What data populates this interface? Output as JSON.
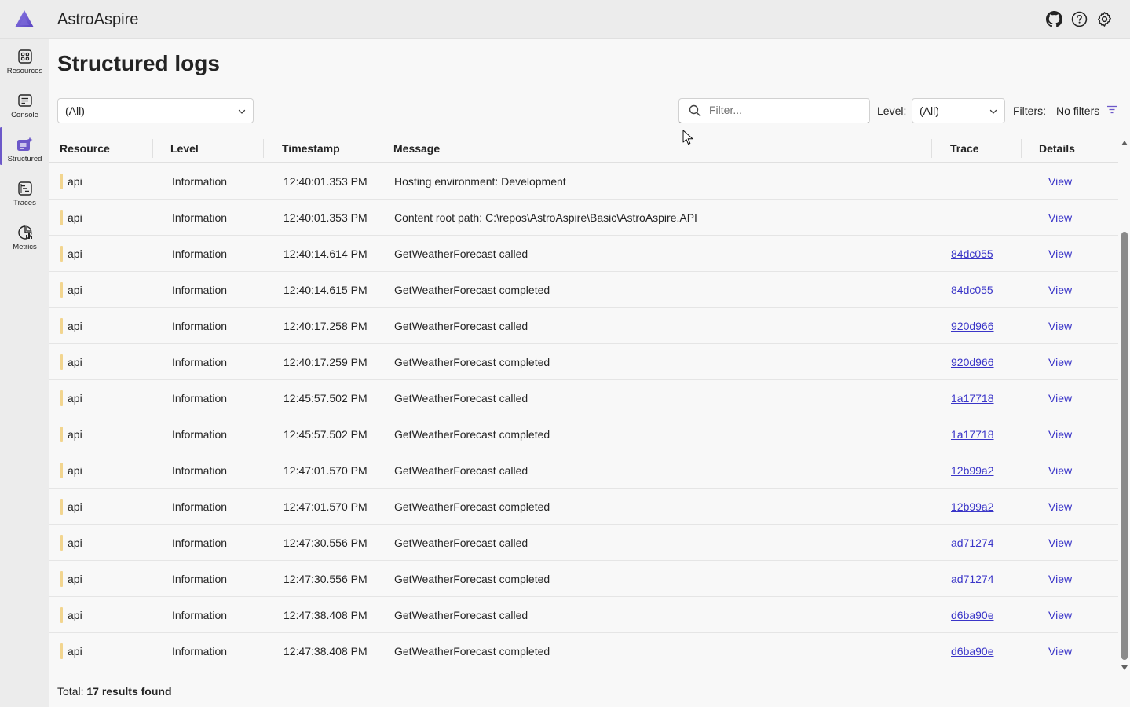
{
  "app": {
    "title": "AstroAspire"
  },
  "header": {
    "icons": [
      "github-icon",
      "help-icon",
      "settings-icon"
    ]
  },
  "sidebar": {
    "items": [
      {
        "label": "Resources",
        "icon": "resources-grid-icon",
        "active": false
      },
      {
        "label": "Console",
        "icon": "console-icon",
        "active": false
      },
      {
        "label": "Structured",
        "icon": "structured-logs-icon",
        "active": true
      },
      {
        "label": "Traces",
        "icon": "traces-icon",
        "active": false
      },
      {
        "label": "Metrics",
        "icon": "metrics-icon",
        "active": false
      }
    ]
  },
  "page": {
    "title": "Structured logs"
  },
  "toolbar": {
    "resource_selected": "(All)",
    "filter_placeholder": "Filter...",
    "level_label": "Level:",
    "level_selected": "(All)",
    "filters_label": "Filters:",
    "filters_value": "No filters"
  },
  "table": {
    "columns": [
      "Resource",
      "Level",
      "Timestamp",
      "Message",
      "Trace",
      "Details"
    ],
    "rows": [
      {
        "resource": "api",
        "level": "Information",
        "timestamp": "12:40:01.353 PM",
        "message": "Hosting environment: Development",
        "trace": "",
        "details": "View"
      },
      {
        "resource": "api",
        "level": "Information",
        "timestamp": "12:40:01.353 PM",
        "message": "Content root path: C:\\repos\\AstroAspire\\Basic\\AstroAspire.API",
        "trace": "",
        "details": "View"
      },
      {
        "resource": "api",
        "level": "Information",
        "timestamp": "12:40:14.614 PM",
        "message": "GetWeatherForecast called",
        "trace": "84dc055",
        "details": "View"
      },
      {
        "resource": "api",
        "level": "Information",
        "timestamp": "12:40:14.615 PM",
        "message": "GetWeatherForecast completed",
        "trace": "84dc055",
        "details": "View"
      },
      {
        "resource": "api",
        "level": "Information",
        "timestamp": "12:40:17.258 PM",
        "message": "GetWeatherForecast called",
        "trace": "920d966",
        "details": "View"
      },
      {
        "resource": "api",
        "level": "Information",
        "timestamp": "12:40:17.259 PM",
        "message": "GetWeatherForecast completed",
        "trace": "920d966",
        "details": "View"
      },
      {
        "resource": "api",
        "level": "Information",
        "timestamp": "12:45:57.502 PM",
        "message": "GetWeatherForecast called",
        "trace": "1a17718",
        "details": "View"
      },
      {
        "resource": "api",
        "level": "Information",
        "timestamp": "12:45:57.502 PM",
        "message": "GetWeatherForecast completed",
        "trace": "1a17718",
        "details": "View"
      },
      {
        "resource": "api",
        "level": "Information",
        "timestamp": "12:47:01.570 PM",
        "message": "GetWeatherForecast called",
        "trace": "12b99a2",
        "details": "View"
      },
      {
        "resource": "api",
        "level": "Information",
        "timestamp": "12:47:01.570 PM",
        "message": "GetWeatherForecast completed",
        "trace": "12b99a2",
        "details": "View"
      },
      {
        "resource": "api",
        "level": "Information",
        "timestamp": "12:47:30.556 PM",
        "message": "GetWeatherForecast called",
        "trace": "ad71274",
        "details": "View"
      },
      {
        "resource": "api",
        "level": "Information",
        "timestamp": "12:47:30.556 PM",
        "message": "GetWeatherForecast completed",
        "trace": "ad71274",
        "details": "View"
      },
      {
        "resource": "api",
        "level": "Information",
        "timestamp": "12:47:38.408 PM",
        "message": "GetWeatherForecast called",
        "trace": "d6ba90e",
        "details": "View"
      },
      {
        "resource": "api",
        "level": "Information",
        "timestamp": "12:47:38.408 PM",
        "message": "GetWeatherForecast completed",
        "trace": "d6ba90e",
        "details": "View"
      }
    ]
  },
  "footer": {
    "total_label": "Total:",
    "total_value": "17 results found"
  },
  "colors": {
    "accent": "#6c58c9",
    "link": "#3a35c8",
    "resource_marker": "#f2d58f"
  }
}
